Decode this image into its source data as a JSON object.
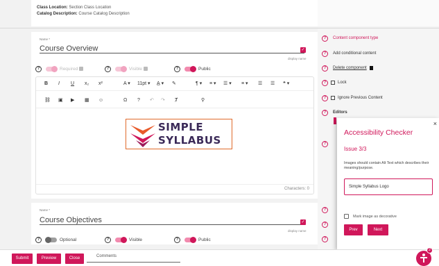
{
  "top": {
    "class_location_label": "Class Location:",
    "class_location_value": "Section Class Location",
    "catalog_desc_label": "Catalog Description:",
    "catalog_desc_value": "Course Catalog Description"
  },
  "section1": {
    "name_label": "Name *",
    "title": "Course Overview",
    "display_hint": "display name",
    "toggles": [
      {
        "label": "Required",
        "state": "on-disabled"
      },
      {
        "label": "Visible",
        "state": "on-disabled"
      },
      {
        "label": "Public",
        "state": "on"
      }
    ],
    "toolbar_row1": [
      "B",
      "I",
      "U",
      "x₂",
      "x²",
      "A ▾",
      "11pt ▾",
      "A̲ ▾",
      "✎",
      "¶ ▾",
      "≡ ▾",
      "☰ ▾",
      "≡ ▾",
      "☰",
      "☰",
      "❝ ▾"
    ],
    "toolbar_row2": [
      "⛓",
      "▣",
      "▶",
      "▦",
      "☺",
      "Ω",
      "?",
      "↶",
      "↷",
      "Ⱦ",
      "⚲"
    ],
    "logo_line1": "SIMPLE",
    "logo_line2": "SYLLABUS",
    "char_count": "Characters: 0"
  },
  "section2": {
    "name_label": "Name *",
    "title": "Course Objectives",
    "display_hint": "display name",
    "toggles": [
      {
        "label": "Optional",
        "state": "off"
      },
      {
        "label": "Visible",
        "state": "on"
      },
      {
        "label": "Public",
        "state": "on"
      }
    ]
  },
  "side": {
    "items": [
      {
        "text": "Content component type",
        "style": "link"
      },
      {
        "text": "Add conditional content",
        "style": "plain"
      },
      {
        "text": "Delete component",
        "style": "under"
      },
      {
        "text": "Lock",
        "style": "check"
      },
      {
        "text": "Ignore Previous Content",
        "style": "check"
      },
      {
        "text": "Editors",
        "style": "bold"
      }
    ]
  },
  "checker": {
    "title": "Accessibility Checker",
    "issue": "Issue 3/3",
    "message": "Images should contain Alt Text which describes their meaning/purpose.",
    "alt_value": "Simple Syllabus Logo",
    "decorative_label": "Mark image as decorative",
    "prev": "Prev",
    "next": "Next",
    "close": "×"
  },
  "bottom": {
    "submit": "Submit",
    "preview": "Preview",
    "close": "Close",
    "comments_label": "Comments",
    "badge_count": "2"
  },
  "colors": {
    "accent": "#d0175a",
    "logo_text": "#3b2a58",
    "logo_border": "#e06a2a"
  }
}
